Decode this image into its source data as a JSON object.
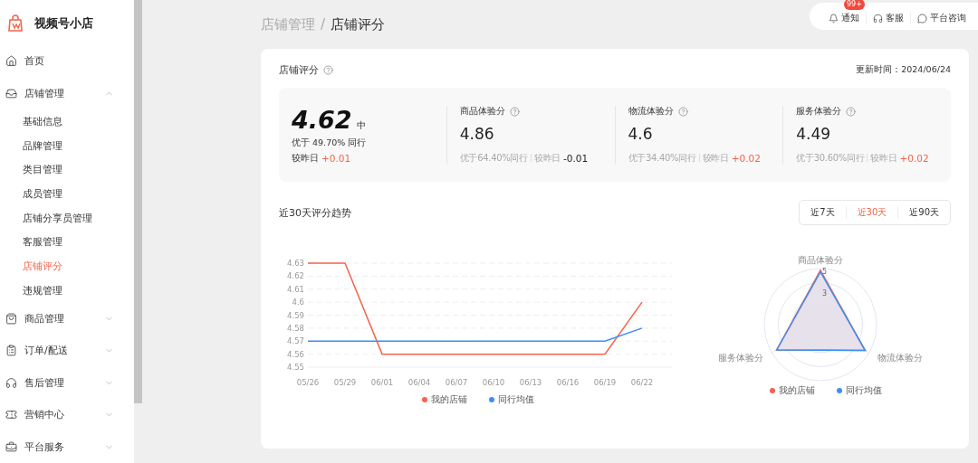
{
  "app": {
    "name": "视频号小店"
  },
  "sidebar": {
    "items": [
      {
        "label": "首页"
      },
      {
        "label": "店铺管理",
        "expanded": true,
        "children": [
          {
            "label": "基础信息",
            "selected": false
          },
          {
            "label": "品牌管理",
            "selected": false
          },
          {
            "label": "类目管理",
            "selected": false
          },
          {
            "label": "成员管理",
            "selected": false
          },
          {
            "label": "店铺分享员管理",
            "selected": false
          },
          {
            "label": "客服管理",
            "selected": false
          },
          {
            "label": "店铺评分",
            "selected": true
          },
          {
            "label": "违规管理",
            "selected": false
          }
        ]
      },
      {
        "label": "商品管理",
        "expanded": false
      },
      {
        "label": "订单/配送",
        "expanded": false
      },
      {
        "label": "售后管理",
        "expanded": false
      },
      {
        "label": "营销中心",
        "expanded": false
      },
      {
        "label": "平台服务",
        "expanded": false
      }
    ]
  },
  "breadcrumb": [
    "店铺管理",
    "店铺评分"
  ],
  "breadcrumb_separator": "/",
  "top_actions": [
    {
      "label": "通知",
      "badge": "99+"
    },
    {
      "label": "客服"
    },
    {
      "label": "平台咨询"
    }
  ],
  "score_card": {
    "title": "店铺评分",
    "updated": "更新时间：2024/06/24",
    "overall": {
      "score": "4.62",
      "grade": "中",
      "beat": "优于 49.70% 同行",
      "compare_label": "较昨日",
      "delta": "+0.01",
      "color": "#f5644b"
    },
    "metrics": [
      {
        "name": "商品体验分",
        "score": "4.86",
        "beat": "优于64.40%同行",
        "compare_label": "较昨日",
        "delta": "-0.01",
        "color": "#222222"
      },
      {
        "name": "物流体验分",
        "score": "4.6",
        "beat": "优于34.40%同行",
        "compare_label": "较昨日",
        "delta": "+0.02",
        "color": "#f5644b"
      },
      {
        "name": "服务体验分",
        "score": "4.49",
        "beat": "优于30.60%同行",
        "compare_label": "较昨日",
        "delta": "+0.02",
        "color": "#f5644b"
      }
    ]
  },
  "trend": {
    "title": "近30天评分趋势",
    "ranges": [
      {
        "label": "近7天",
        "selected": false
      },
      {
        "label": "近30天",
        "selected": true
      },
      {
        "label": "近90天",
        "selected": false
      }
    ],
    "chart_data": {
      "type": "line",
      "categories": [
        "05/26",
        "05/29",
        "06/01",
        "06/04",
        "06/07",
        "06/10",
        "06/13",
        "06/16",
        "06/19",
        "06/22"
      ],
      "ylim": [
        4.55,
        4.63
      ],
      "grid": true,
      "legend": "bottom",
      "yticks": [
        {
          "value": 4.55,
          "label": "4.55"
        },
        {
          "value": 4.56,
          "label": "4.56"
        },
        {
          "value": 4.57,
          "label": "4.57"
        },
        {
          "value": 4.58,
          "label": "4.58"
        },
        {
          "value": 4.59,
          "label": "4.59"
        },
        {
          "value": 4.6,
          "label": "4.6"
        },
        {
          "value": 4.61,
          "label": "4.61"
        },
        {
          "value": 4.62,
          "label": "4.62"
        },
        {
          "value": 4.63,
          "label": "4.63"
        }
      ],
      "series": [
        {
          "name": "我的店铺",
          "color": "#f5644b",
          "values": [
            4.63,
            4.63,
            4.56,
            4.56,
            4.56,
            4.56,
            4.56,
            4.56,
            4.56,
            4.6
          ]
        },
        {
          "name": "同行均值",
          "color": "#3d8ef5",
          "values": [
            4.57,
            4.57,
            4.57,
            4.57,
            4.57,
            4.57,
            4.57,
            4.57,
            4.57,
            4.58
          ]
        }
      ]
    },
    "radar": {
      "axes": [
        "商品体验分",
        "服务体验分",
        "物流体验分"
      ],
      "ticks": [
        "5",
        "3"
      ],
      "legend": [
        {
          "name": "我的店铺",
          "color": "#f5644b"
        },
        {
          "name": "同行均值",
          "color": "#3d8ef5"
        }
      ]
    }
  }
}
